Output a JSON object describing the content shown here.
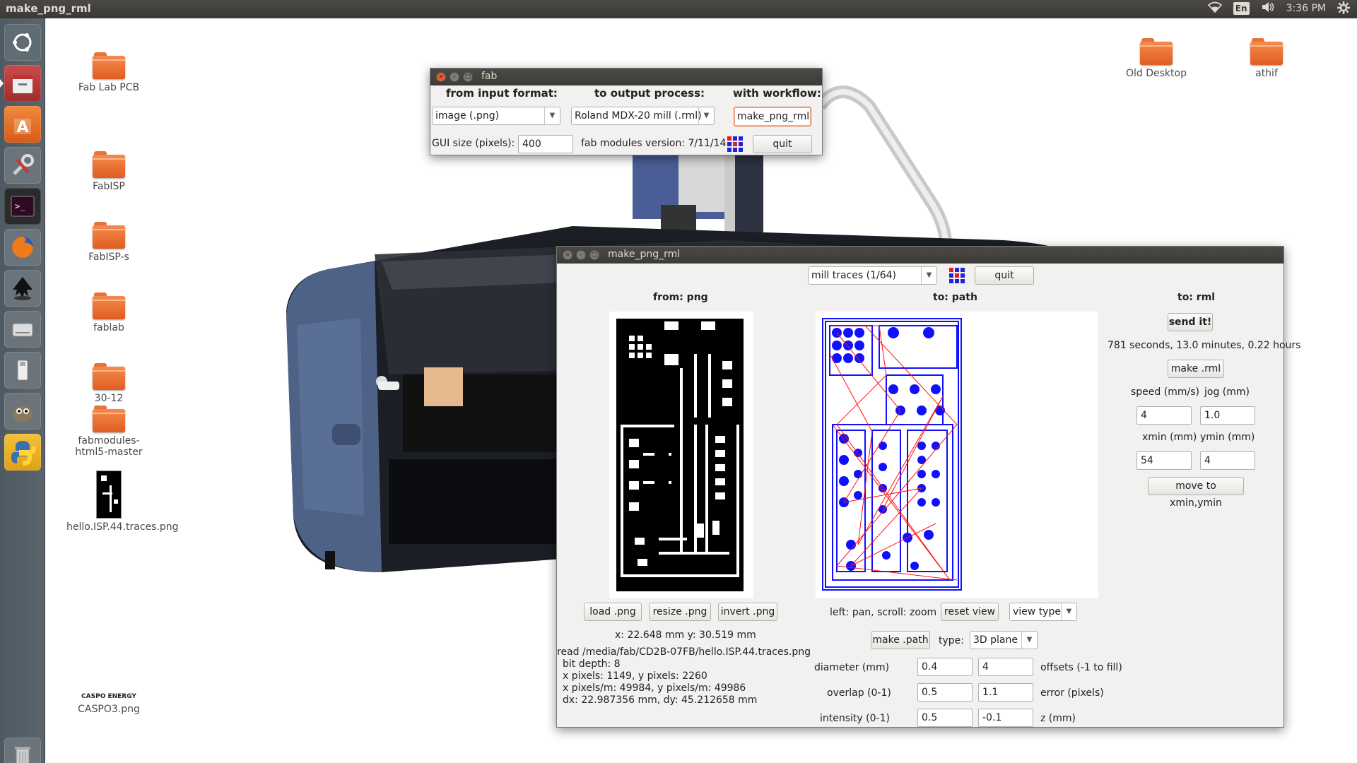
{
  "topbar": {
    "title": "make_png_rml",
    "lang": "En",
    "clock": "3:36 PM"
  },
  "desktop": {
    "icons": [
      {
        "label": "Fab Lab PCB"
      },
      {
        "label": "FabISP"
      },
      {
        "label": "FabISP-s"
      },
      {
        "label": "fablab"
      },
      {
        "label": "30-12"
      },
      {
        "label": "fabmodules-html5-master"
      },
      {
        "label": "hello.ISP.44.traces.png"
      },
      {
        "label": "CASPO3.png",
        "thumb_text": "CASPO ENERGY"
      },
      {
        "label": "Old Desktop"
      },
      {
        "label": "athif"
      }
    ]
  },
  "fab_window": {
    "title": "fab",
    "from_label": "from input format:",
    "to_label": "to output process:",
    "workflow_label": "with workflow:",
    "input_format": "image (.png)",
    "output_process": "Roland MDX-20 mill (.rml)",
    "workflow": "make_png_rml",
    "gui_size_label": "GUI size (pixels):",
    "gui_size": "400",
    "version": "fab modules version: 7/11/14",
    "quit": "quit"
  },
  "rml_window": {
    "title": "make_png_rml",
    "mode": "mill traces (1/64)",
    "quit": "quit",
    "from_title": "from: png",
    "path_title": "to: path",
    "rml_title": "to: rml",
    "send": "send it!",
    "time": "781 seconds, 13.0 minutes, 0.22 hours",
    "make_rml": "make .rml",
    "speed_label": "speed (mm/s)",
    "jog_label": "jog (mm)",
    "speed": "4",
    "jog": "1.0",
    "xmin_label": "xmin (mm)",
    "ymin_label": "ymin (mm)",
    "xmin": "54",
    "ymin": "4",
    "move": "move to xmin,ymin",
    "load_png": "load .png",
    "resize_png": "resize .png",
    "invert_png": "invert .png",
    "coords": "x: 22.648 mm  y: 30.519 mm",
    "file_info": [
      "read /media/fab/CD2B-07FB/hello.ISP.44.traces.png",
      "bit depth: 8",
      "x pixels: 1149, y pixels: 2260",
      "x pixels/m: 49984, y pixels/m: 49986",
      "dx: 22.987356 mm, dy: 45.212658 mm"
    ],
    "pan_hint": "left: pan, scroll: zoom",
    "reset_view": "reset view",
    "view_type": "view type",
    "make_path": "make .path",
    "type_label": "type:",
    "type_value": "3D plane",
    "diameter_label": "diameter (mm)",
    "diameter": "0.4",
    "offsets": "4",
    "offsets_label": "offsets (-1 to fill)",
    "overlap_label": "overlap (0-1)",
    "overlap": "0.5",
    "error": "1.1",
    "error_label": "error (pixels)",
    "intensity_label": "intensity (0-1)",
    "intensity": "0.5",
    "z": "-0.1",
    "z_label": "z (mm)"
  }
}
